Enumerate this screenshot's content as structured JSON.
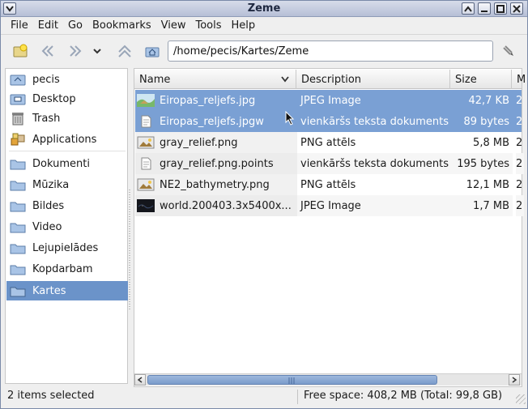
{
  "window": {
    "title": "Zeme"
  },
  "menubar": {
    "items": [
      "File",
      "Edit",
      "Go",
      "Bookmarks",
      "View",
      "Tools",
      "Help"
    ]
  },
  "toolbar": {
    "location": "/home/pecis/Kartes/Zeme",
    "icons": [
      "new-folder-icon",
      "back-icon",
      "forward-icon",
      "dropdown-icon",
      "up-icon",
      "home-icon",
      "clear-icon"
    ]
  },
  "sidebar": {
    "items": [
      {
        "label": "pecis",
        "icon": "home-folder-icon"
      },
      {
        "label": "Desktop",
        "icon": "desktop-icon"
      },
      {
        "label": "Trash",
        "icon": "trash-icon"
      },
      {
        "label": "Applications",
        "icon": "applications-icon"
      },
      {
        "label": "Dokumenti",
        "icon": "folder-icon"
      },
      {
        "label": "Mūzika",
        "icon": "folder-icon"
      },
      {
        "label": "Bildes",
        "icon": "folder-icon"
      },
      {
        "label": "Video",
        "icon": "folder-icon"
      },
      {
        "label": "Lejupielādes",
        "icon": "folder-icon"
      },
      {
        "label": "Kopdarbam",
        "icon": "folder-icon"
      },
      {
        "label": "Kartes",
        "icon": "folder-icon",
        "selected": true
      }
    ]
  },
  "filelist": {
    "columns": [
      "Name",
      "Description",
      "Size",
      "M"
    ],
    "rows": [
      {
        "name": "Eiropas_reljefs.jpg",
        "description": "JPEG Image",
        "size": "42,7 KB",
        "extra": "2",
        "selected": true,
        "thumb": "map-thumb"
      },
      {
        "name": "Eiropas_reljefs.jpgw",
        "description": "vienkāršs teksta dokuments",
        "size": "89 bytes",
        "extra": "2",
        "selected": true,
        "thumb": "text-doc"
      },
      {
        "name": "gray_relief.png",
        "description": "PNG attēls",
        "size": "5,8 MB",
        "extra": "2",
        "selected": false,
        "thumb": "image-thumb"
      },
      {
        "name": "gray_relief.png.points",
        "description": "vienkāršs teksta dokuments",
        "size": "195 bytes",
        "extra": "2",
        "selected": false,
        "thumb": "text-doc"
      },
      {
        "name": "NE2_bathymetry.png",
        "description": "PNG attēls",
        "size": "12,1 MB",
        "extra": "2",
        "selected": false,
        "thumb": "image-thumb"
      },
      {
        "name": "world.200403.3x5400x...",
        "description": "JPEG Image",
        "size": "1,7 MB",
        "extra": "2",
        "selected": false,
        "thumb": "dark-thumb"
      }
    ]
  },
  "statusbar": {
    "selection": "2 items selected",
    "free_space": "Free space: 408,2 MB (Total: 99,8 GB)"
  },
  "colors": {
    "selection": "#7aa0d4",
    "sidebar_selection": "#6b93c9"
  }
}
